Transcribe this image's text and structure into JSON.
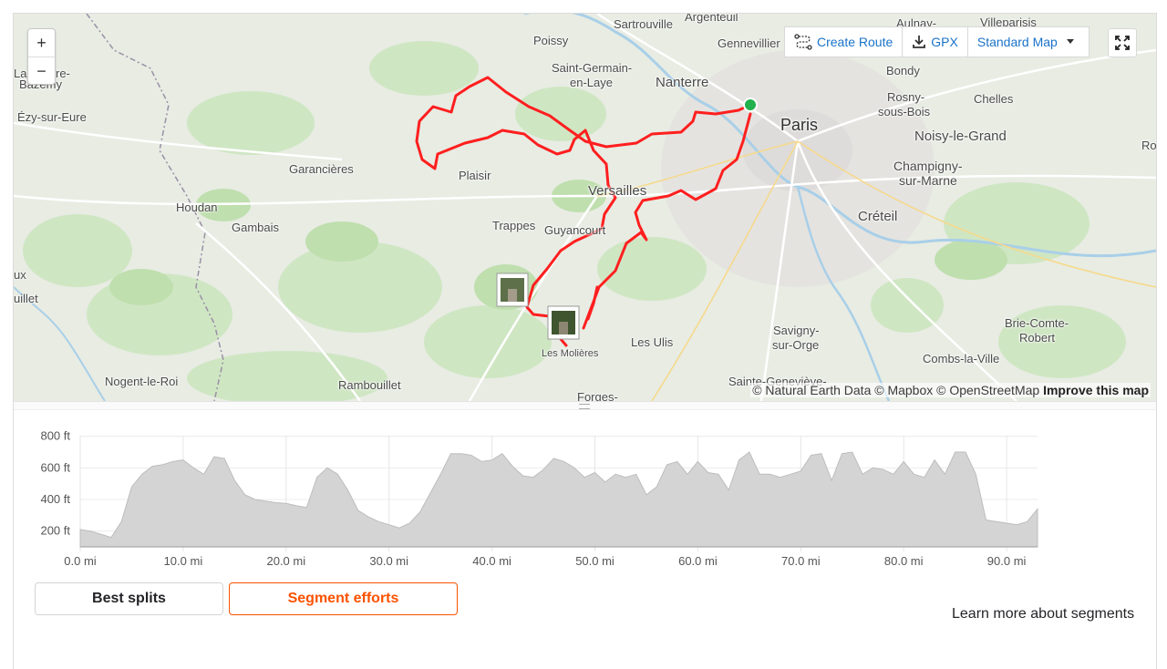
{
  "map": {
    "zoom_in": "+",
    "zoom_out": "−",
    "places": {
      "sartrouville": "Sartrouville",
      "argenteuil": "Argenteuil",
      "aulnay": "Aulnay-",
      "villeparisis": "Villeparisis",
      "poissy": "Poissy",
      "gennevilliers": "Gennevillier",
      "saint_germain_1": "Saint-Germain-",
      "saint_germain_2": "en-Laye",
      "nanterre": "Nanterre",
      "bondy": "Bondy",
      "la_verriere_1": "La",
      "la_verriere_2": "re-",
      "la_verriere_3": "Bazemy",
      "rosny_1": "Rosny-",
      "rosny_2": "sous-Bois",
      "chelles": "Chelles",
      "ezy": "Ézy-sur-Eure",
      "paris": "Paris",
      "noisy": "Noisy-le-Grand",
      "ro": "Ro",
      "garancieres": "Garancières",
      "plaisir": "Plaisir",
      "champigny_1": "Champigny-",
      "champigny_2": "sur-Marne",
      "versailles": "Versailles",
      "houdan": "Houdan",
      "gambais": "Gambais",
      "trappes": "Trappes",
      "guyancourt": "Guyancourt",
      "creteil": "Créteil",
      "ux": "ux",
      "uillet": "uillet",
      "brie_1": "Brie-Comte-",
      "brie_2": "Robert",
      "savigny_1": "Savigny-",
      "savigny_2": "sur-Orge",
      "les_ulis": "Les Ulis",
      "les_molieres": "Les Molières",
      "combs": "Combs-la-Ville",
      "nogent": "Nogent-le-Roi",
      "rambouillet": "Rambouillet",
      "sainte_genevieve": "Sainte-Geneviève-",
      "forges": "Forges-"
    },
    "toolbar": {
      "create_route": "Create Route",
      "gpx": "GPX",
      "map_style": "Standard Map"
    },
    "attribution": {
      "text": "© Natural Earth Data © Mapbox © OpenStreetMap",
      "improve": "Improve this map"
    },
    "colors": {
      "route": "#ff1f1f",
      "start_marker": "#22b14c"
    }
  },
  "elevation": {
    "y_ticks": [
      "800 ft",
      "600 ft",
      "400 ft",
      "200 ft"
    ],
    "x_ticks": [
      "0.0 mi",
      "10.0 mi",
      "20.0 mi",
      "30.0 mi",
      "40.0 mi",
      "50.0 mi",
      "60.0 mi",
      "70.0 mi",
      "80.0 mi",
      "90.0 mi"
    ]
  },
  "chart_data": {
    "type": "area",
    "xlabel": "",
    "ylabel": "",
    "x_unit": "mi",
    "y_unit": "ft",
    "xlim": [
      0,
      93
    ],
    "ylim": [
      100,
      850
    ],
    "grid": true,
    "x": [
      0,
      1,
      2,
      3,
      4,
      5,
      6,
      7,
      8,
      9,
      10,
      11,
      12,
      13,
      14,
      15,
      16,
      17,
      18,
      19,
      20,
      21,
      22,
      23,
      24,
      25,
      26,
      27,
      28,
      29,
      30,
      31,
      32,
      33,
      34,
      35,
      36,
      37,
      38,
      39,
      40,
      41,
      42,
      43,
      44,
      45,
      46,
      47,
      48,
      49,
      50,
      51,
      52,
      53,
      54,
      55,
      56,
      57,
      58,
      59,
      60,
      61,
      62,
      63,
      64,
      65,
      66,
      67,
      68,
      69,
      70,
      71,
      72,
      73,
      74,
      75,
      76,
      77,
      78,
      79,
      80,
      81,
      82,
      83,
      84,
      85,
      86,
      87,
      88,
      89,
      90,
      91,
      92,
      93
    ],
    "y": [
      210,
      200,
      180,
      160,
      260,
      480,
      560,
      610,
      620,
      640,
      650,
      600,
      560,
      670,
      660,
      520,
      430,
      400,
      390,
      380,
      375,
      360,
      350,
      540,
      600,
      560,
      460,
      330,
      290,
      260,
      240,
      220,
      250,
      320,
      440,
      560,
      690,
      690,
      680,
      640,
      650,
      690,
      610,
      550,
      540,
      590,
      660,
      640,
      600,
      540,
      570,
      510,
      560,
      540,
      560,
      430,
      480,
      620,
      640,
      560,
      640,
      570,
      560,
      460,
      650,
      700,
      560,
      560,
      540,
      560,
      580,
      680,
      690,
      520,
      690,
      700,
      560,
      600,
      590,
      560,
      640,
      560,
      540,
      650,
      560,
      700,
      700,
      560,
      270,
      260,
      250,
      240,
      260,
      340
    ]
  },
  "controls": {
    "best_splits": "Best splits",
    "segment_efforts": "Segment efforts",
    "learn_more": "Learn more about segments",
    "accent": "#fc5200"
  }
}
